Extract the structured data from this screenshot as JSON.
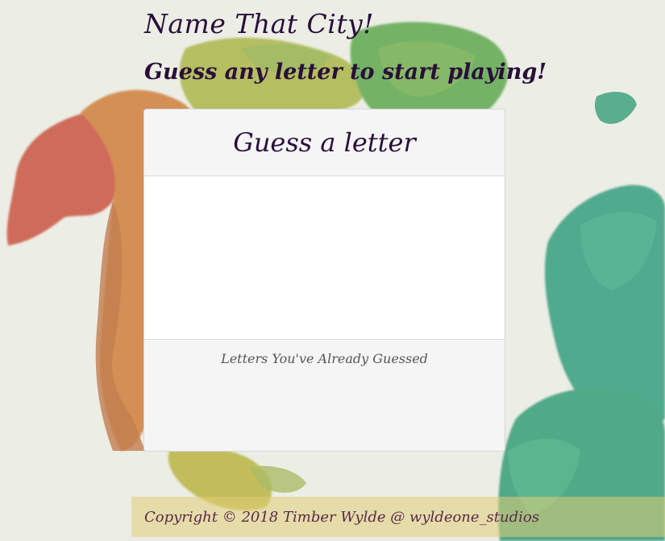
{
  "game": {
    "title": "Name That City!",
    "instruction": "Guess any letter to start playing!"
  },
  "panel": {
    "heading": "Guess a letter",
    "word_display": "",
    "guessed_label": "Letters You've Already Guessed",
    "guessed_letters": ""
  },
  "footer": {
    "copyright": "Copyright © 2018 Timber Wylde @ wyldeone_studios"
  },
  "colors": {
    "title_text": "#2a0e3a",
    "footer_bg": "#e2cd78",
    "footer_text": "#5a2a46",
    "map_red": "#c4483a",
    "map_orange": "#cf7a35",
    "map_yellow": "#b9b53a",
    "map_green": "#6aa84a",
    "map_teal": "#2f9c7a"
  }
}
